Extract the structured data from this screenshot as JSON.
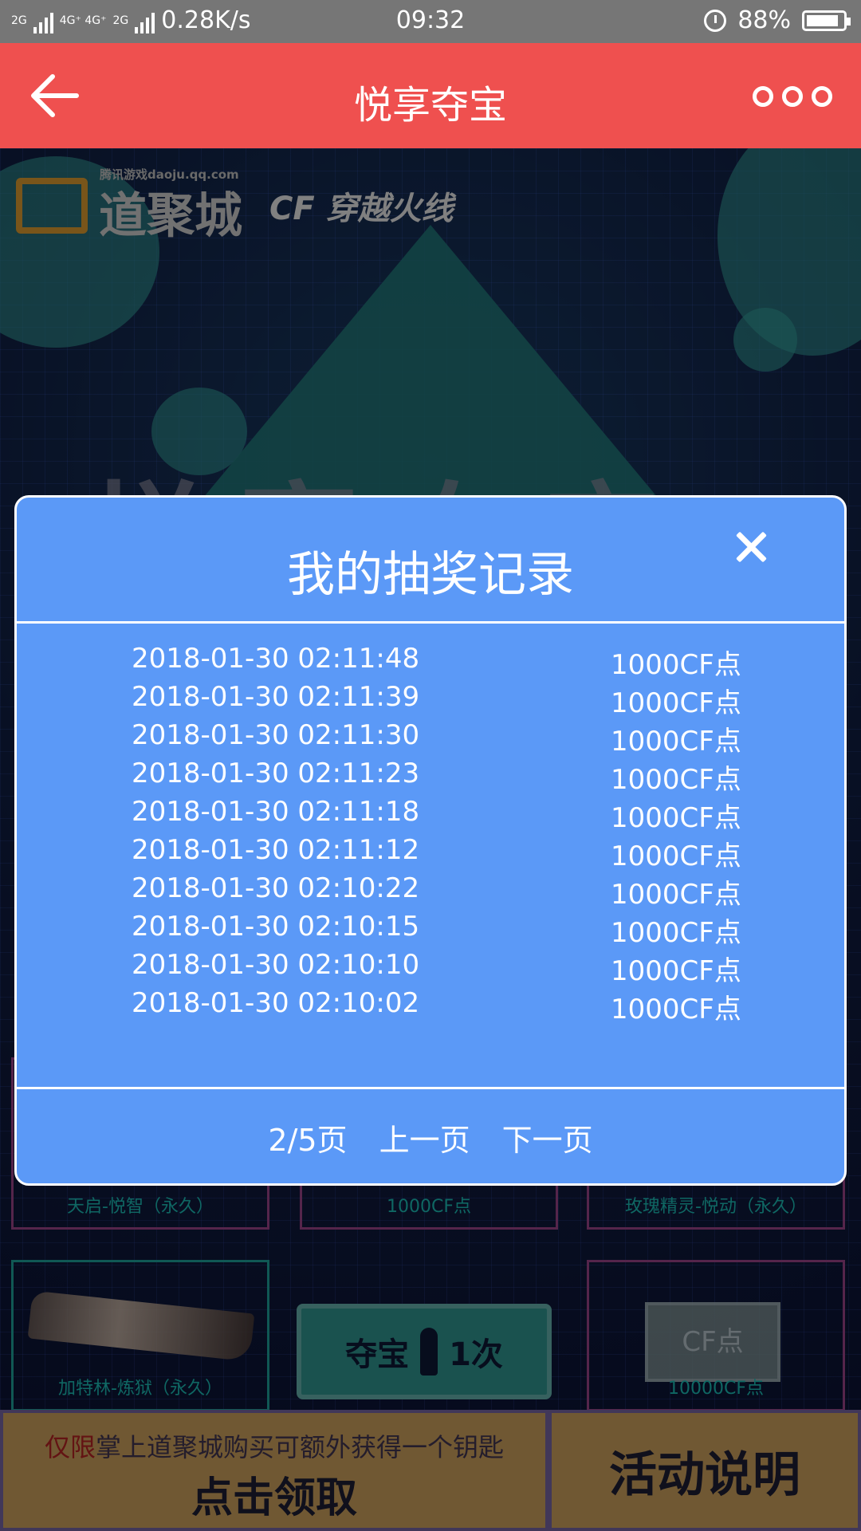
{
  "statusbar": {
    "net_left": "2G",
    "net_right": "4G⁺ 4G⁺",
    "net_right_sub": "2G",
    "speed": "0.28K/s",
    "time": "09:32",
    "battery": "88%"
  },
  "header": {
    "title": "悦享夺宝"
  },
  "background": {
    "site": "腾讯游戏daoju.qq.com",
    "brand": "道聚城",
    "game": "CF 穿越火线",
    "big_title": "悦享夺宝",
    "prizes": [
      {
        "label": "天启-悦智（永久）"
      },
      {
        "label": "1000CF点"
      },
      {
        "label": "玫瑰精灵-悦动（永久）"
      },
      {
        "label": "加特林-炼狱（永久）"
      },
      {
        "label": "10000CF点"
      }
    ],
    "tickets_text": "CF点",
    "draw_button": {
      "left": "夺宝",
      "right": "1次"
    },
    "promo": {
      "highlight": "仅限",
      "text": "掌上道聚城购买可额外获得一个钥匙"
    },
    "claim_label": "点击领取",
    "rules_label": "活动说明"
  },
  "modal": {
    "title": "我的抽奖记录",
    "records": [
      {
        "date": "2018-01-30 02:11:48",
        "prize": "1000CF点"
      },
      {
        "date": "2018-01-30 02:11:39",
        "prize": "1000CF点"
      },
      {
        "date": "2018-01-30 02:11:30",
        "prize": "1000CF点"
      },
      {
        "date": "2018-01-30 02:11:23",
        "prize": "1000CF点"
      },
      {
        "date": "2018-01-30 02:11:18",
        "prize": "1000CF点"
      },
      {
        "date": "2018-01-30 02:11:12",
        "prize": "1000CF点"
      },
      {
        "date": "2018-01-30 02:10:22",
        "prize": "1000CF点"
      },
      {
        "date": "2018-01-30 02:10:15",
        "prize": "1000CF点"
      },
      {
        "date": "2018-01-30 02:10:10",
        "prize": "1000CF点"
      },
      {
        "date": "2018-01-30 02:10:02",
        "prize": "1000CF点"
      }
    ],
    "page_indicator": "2/5页",
    "prev_label": "上一页",
    "next_label": "下一页"
  },
  "colors": {
    "header_bg": "#ef504f",
    "modal_bg": "#5b99f7",
    "statusbar_bg": "#767676"
  }
}
